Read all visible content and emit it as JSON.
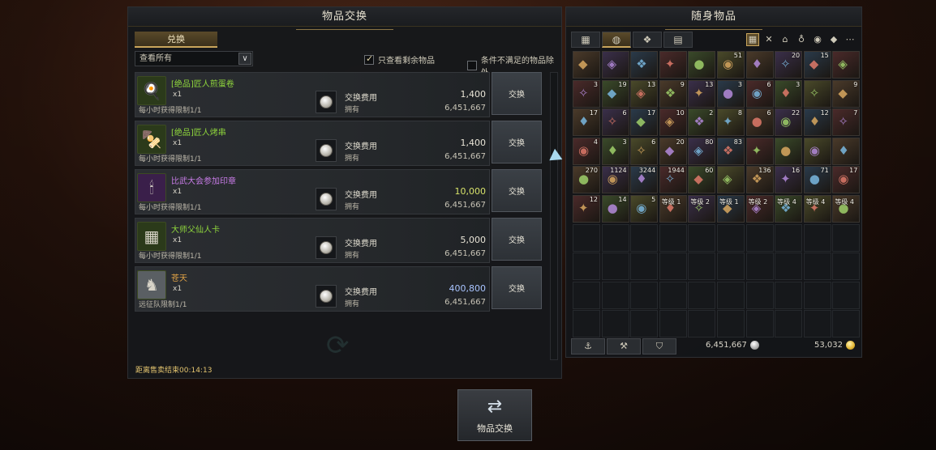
{
  "exchange": {
    "title": "物品交换",
    "tab_label": "兑换",
    "filter_value": "查看所有",
    "check1_label": "只查看剩余物品",
    "check2_label": "条件不满足的物品除外",
    "cost_label": "交换费用",
    "own_label": "拥有",
    "button_label": "交换",
    "timer": "距离售卖结束00:14:13",
    "items": [
      {
        "name": "[绝品]匠人煎蛋卷",
        "name_color": "#8fd63c",
        "qty": "x1",
        "limit": "每小时获得限制1/1",
        "cost": "1,400",
        "cost_color": "#e8e4d6",
        "owned": "6,451,667",
        "icon": "omelet-icon",
        "icon_bg": "#2b3a1a"
      },
      {
        "name": "[绝品]匠人烤串",
        "name_color": "#8fd63c",
        "qty": "x1",
        "limit": "每小时获得限制1/1",
        "cost": "1,400",
        "cost_color": "#e8e4d6",
        "owned": "6,451,667",
        "icon": "skewer-icon",
        "icon_bg": "#2b3a1a"
      },
      {
        "name": "比武大会参加印章",
        "name_color": "#c77be6",
        "qty": "x1",
        "limit": "每小时获得限制1/1",
        "cost": "10,000",
        "cost_color": "#d7e26a",
        "owned": "6,451,667",
        "icon": "seal-icon",
        "icon_bg": "#3a1f4a"
      },
      {
        "name": "大师父仙人卡",
        "name_color": "#8fd63c",
        "qty": "x1",
        "limit": "每小时获得限制1/1",
        "cost": "5,000",
        "cost_color": "#e8e4d6",
        "owned": "6,451,667",
        "icon": "card-icon",
        "icon_bg": "#2b3a1a"
      },
      {
        "name": "苍天",
        "name_color": "#e0a246",
        "qty": "x1",
        "limit": "远征队限制1/1",
        "cost": "400,800",
        "cost_color": "#a9c4ff",
        "owned": "6,451,667",
        "icon": "horse-icon",
        "icon_bg": "#5a5f63"
      }
    ]
  },
  "inventory": {
    "title": "随身物品",
    "tabs": [
      {
        "icon": "grid-icon",
        "glyph": "▦"
      },
      {
        "icon": "bag-icon",
        "glyph": "◍"
      },
      {
        "icon": "pet-icon",
        "glyph": "❖"
      },
      {
        "icon": "book-icon",
        "glyph": "▤"
      }
    ],
    "filters": [
      {
        "icon": "all-icon",
        "glyph": "▦"
      },
      {
        "icon": "tools-icon",
        "glyph": "✕"
      },
      {
        "icon": "helmet-icon",
        "glyph": "⌂"
      },
      {
        "icon": "potion-icon",
        "glyph": "♁"
      },
      {
        "icon": "gem-icon",
        "glyph": "◉"
      },
      {
        "icon": "material-icon",
        "glyph": "◆"
      },
      {
        "icon": "more-icon",
        "glyph": "⋯"
      }
    ],
    "rows": [
      [
        "",
        "",
        "",
        "",
        "",
        "51",
        "",
        "20",
        "15",
        ""
      ],
      [
        "3",
        "19",
        "13",
        "9",
        "13",
        "3",
        "6",
        "3",
        "",
        "9"
      ],
      [
        "17",
        "6",
        "17",
        "10",
        "2",
        "8",
        "6",
        "22",
        "12",
        "7"
      ],
      [
        "4",
        "3",
        "6",
        "20",
        "80",
        "83",
        "",
        "",
        "",
        ""
      ],
      [
        "270",
        "1124",
        "3244",
        "1944",
        "60",
        "",
        "136",
        "16",
        "71",
        "17"
      ],
      [
        "12",
        "14",
        "5",
        "等级 1",
        "等级 2",
        "等级 1",
        "等级 2",
        "等级 4",
        "等级 4",
        "等级 4"
      ]
    ],
    "silver": "6,451,667",
    "gold": "53,032",
    "tool_buttons": [
      {
        "icon": "anchor-icon",
        "glyph": "⚓"
      },
      {
        "icon": "hammer-icon",
        "glyph": "⚒"
      },
      {
        "icon": "shield-icon",
        "glyph": "⛉"
      }
    ]
  },
  "hotbar": {
    "label": "物品交换",
    "icon": "exchange-icon"
  }
}
